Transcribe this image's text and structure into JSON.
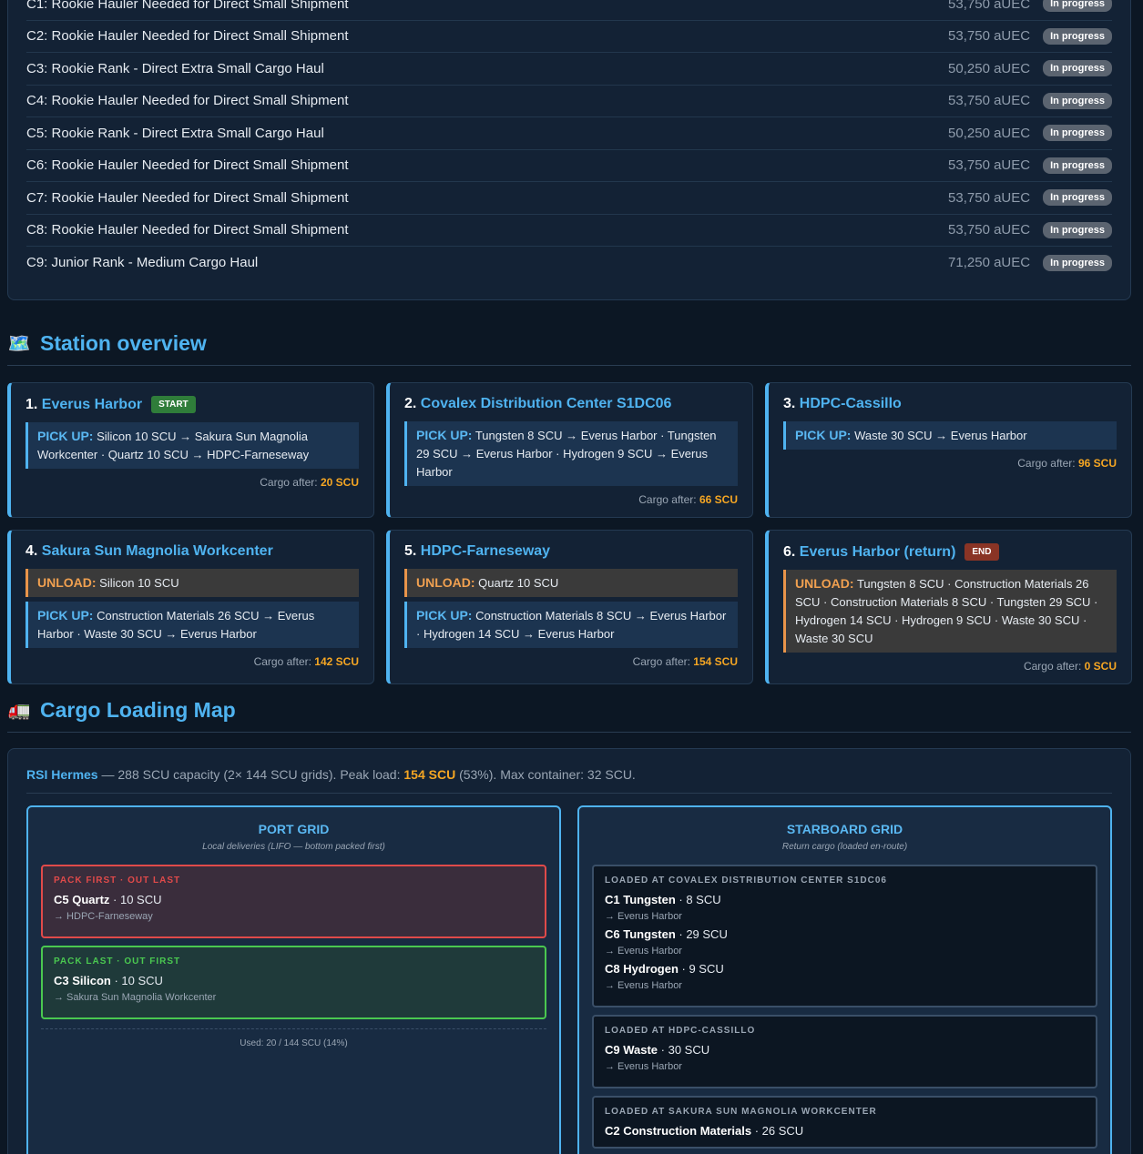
{
  "contracts": [
    {
      "title": "C1: Rookie Hauler Needed for Direct Small Shipment",
      "reward": "53,750 aUEC",
      "status": "In progress"
    },
    {
      "title": "C2: Rookie Hauler Needed for Direct Small Shipment",
      "reward": "53,750 aUEC",
      "status": "In progress"
    },
    {
      "title": "C3: Rookie Rank - Direct Extra Small Cargo Haul",
      "reward": "50,250 aUEC",
      "status": "In progress"
    },
    {
      "title": "C4: Rookie Hauler Needed for Direct Small Shipment",
      "reward": "53,750 aUEC",
      "status": "In progress"
    },
    {
      "title": "C5: Rookie Rank - Direct Extra Small Cargo Haul",
      "reward": "50,250 aUEC",
      "status": "In progress"
    },
    {
      "title": "C6: Rookie Hauler Needed for Direct Small Shipment",
      "reward": "53,750 aUEC",
      "status": "In progress"
    },
    {
      "title": "C7: Rookie Hauler Needed for Direct Small Shipment",
      "reward": "53,750 aUEC",
      "status": "In progress"
    },
    {
      "title": "C8: Rookie Hauler Needed for Direct Small Shipment",
      "reward": "53,750 aUEC",
      "status": "In progress"
    },
    {
      "title": "C9: Junior Rank - Medium Cargo Haul",
      "reward": "71,250 aUEC",
      "status": "In progress"
    }
  ],
  "station_overview": {
    "icon": "🗺️",
    "icon_name": "map-icon",
    "title": "Station overview"
  },
  "stations": [
    {
      "num": "1.",
      "name": "Everus Harbor",
      "badge": "START",
      "badge_type": "start",
      "actions": [
        {
          "type": "pickup",
          "label": "PICK UP:",
          "text": "Silicon 10 SCU → Sakura Sun Magnolia Workcenter · Quartz 10 SCU → HDPC-Farneseway"
        }
      ],
      "cargo_label": "Cargo after:",
      "cargo_after": "20 SCU"
    },
    {
      "num": "2.",
      "name": "Covalex Distribution Center S1DC06",
      "badge": "",
      "badge_type": "",
      "actions": [
        {
          "type": "pickup",
          "label": "PICK UP:",
          "text": "Tungsten 8 SCU → Everus Harbor · Tungsten 29 SCU → Everus Harbor · Hydrogen 9 SCU → Everus Harbor"
        }
      ],
      "cargo_label": "Cargo after:",
      "cargo_after": "66 SCU"
    },
    {
      "num": "3.",
      "name": "HDPC-Cassillo",
      "badge": "",
      "badge_type": "",
      "actions": [
        {
          "type": "pickup",
          "label": "PICK UP:",
          "text": "Waste 30 SCU → Everus Harbor"
        }
      ],
      "cargo_label": "Cargo after:",
      "cargo_after": "96 SCU"
    },
    {
      "num": "4.",
      "name": "Sakura Sun Magnolia Workcenter",
      "badge": "",
      "badge_type": "",
      "actions": [
        {
          "type": "unload",
          "label": "UNLOAD:",
          "text": "Silicon 10 SCU"
        },
        {
          "type": "pickup",
          "label": "PICK UP:",
          "text": "Construction Materials 26 SCU → Everus Harbor · Waste 30 SCU → Everus Harbor"
        }
      ],
      "cargo_label": "Cargo after:",
      "cargo_after": "142 SCU"
    },
    {
      "num": "5.",
      "name": "HDPC-Farneseway",
      "badge": "",
      "badge_type": "",
      "actions": [
        {
          "type": "unload",
          "label": "UNLOAD:",
          "text": "Quartz 10 SCU"
        },
        {
          "type": "pickup",
          "label": "PICK UP:",
          "text": "Construction Materials 8 SCU → Everus Harbor · Hydrogen 14 SCU → Everus Harbor"
        }
      ],
      "cargo_label": "Cargo after:",
      "cargo_after": "154 SCU"
    },
    {
      "num": "6.",
      "name": "Everus Harbor (return)",
      "badge": "END",
      "badge_type": "end",
      "actions": [
        {
          "type": "unload",
          "label": "UNLOAD:",
          "text": "Tungsten 8 SCU · Construction Materials 26 SCU · Construction Materials 8 SCU · Tungsten 29 SCU · Hydrogen 14 SCU · Hydrogen 9 SCU · Waste 30 SCU · Waste 30 SCU"
        }
      ],
      "cargo_label": "Cargo after:",
      "cargo_after": "0 SCU"
    }
  ],
  "cargo_map": {
    "icon": "🚛",
    "icon_name": "truck-icon",
    "title": "Cargo Loading Map",
    "ship_name": "RSI Hermes",
    "ship_desc_1": " — 288 SCU capacity (2× 144 SCU grids). Peak load: ",
    "peak": "154 SCU",
    "ship_desc_2": " (53%). Max container: 32 SCU.",
    "port": {
      "title": "PORT GRID",
      "subtitle": "Local deliveries (LIFO — bottom packed first)",
      "slots": [
        {
          "kind": "first",
          "tag": "PACK FIRST · OUT LAST",
          "items": [
            {
              "name": "C5 Quartz",
              "qty": " · 10 SCU",
              "dest": "→ HDPC-Farneseway"
            }
          ]
        },
        {
          "kind": "last",
          "tag": "PACK LAST · OUT FIRST",
          "items": [
            {
              "name": "C3 Silicon",
              "qty": " · 10 SCU",
              "dest": "→ Sakura Sun Magnolia Workcenter"
            }
          ]
        }
      ],
      "used": "Used: 20 / 144 SCU (14%)"
    },
    "starboard": {
      "title": "STARBOARD GRID",
      "subtitle": "Return cargo (loaded en-route)",
      "slots": [
        {
          "kind": "dark",
          "tag": "LOADED AT COVALEX DISTRIBUTION CENTER S1DC06",
          "items": [
            {
              "name": "C1 Tungsten",
              "qty": " · 8 SCU",
              "dest": "→ Everus Harbor"
            },
            {
              "name": "C6 Tungsten",
              "qty": " · 29 SCU",
              "dest": "→ Everus Harbor"
            },
            {
              "name": "C8 Hydrogen",
              "qty": " · 9 SCU",
              "dest": "→ Everus Harbor"
            }
          ]
        },
        {
          "kind": "dark",
          "tag": "LOADED AT HDPC-CASSILLO",
          "items": [
            {
              "name": "C9 Waste",
              "qty": " · 30 SCU",
              "dest": "→ Everus Harbor"
            }
          ]
        },
        {
          "kind": "dark",
          "tag": "LOADED AT SAKURA SUN MAGNOLIA WORKCENTER",
          "items": [
            {
              "name": "C2 Construction Materials",
              "qty": " · 26 SCU",
              "dest": ""
            }
          ]
        }
      ]
    }
  }
}
